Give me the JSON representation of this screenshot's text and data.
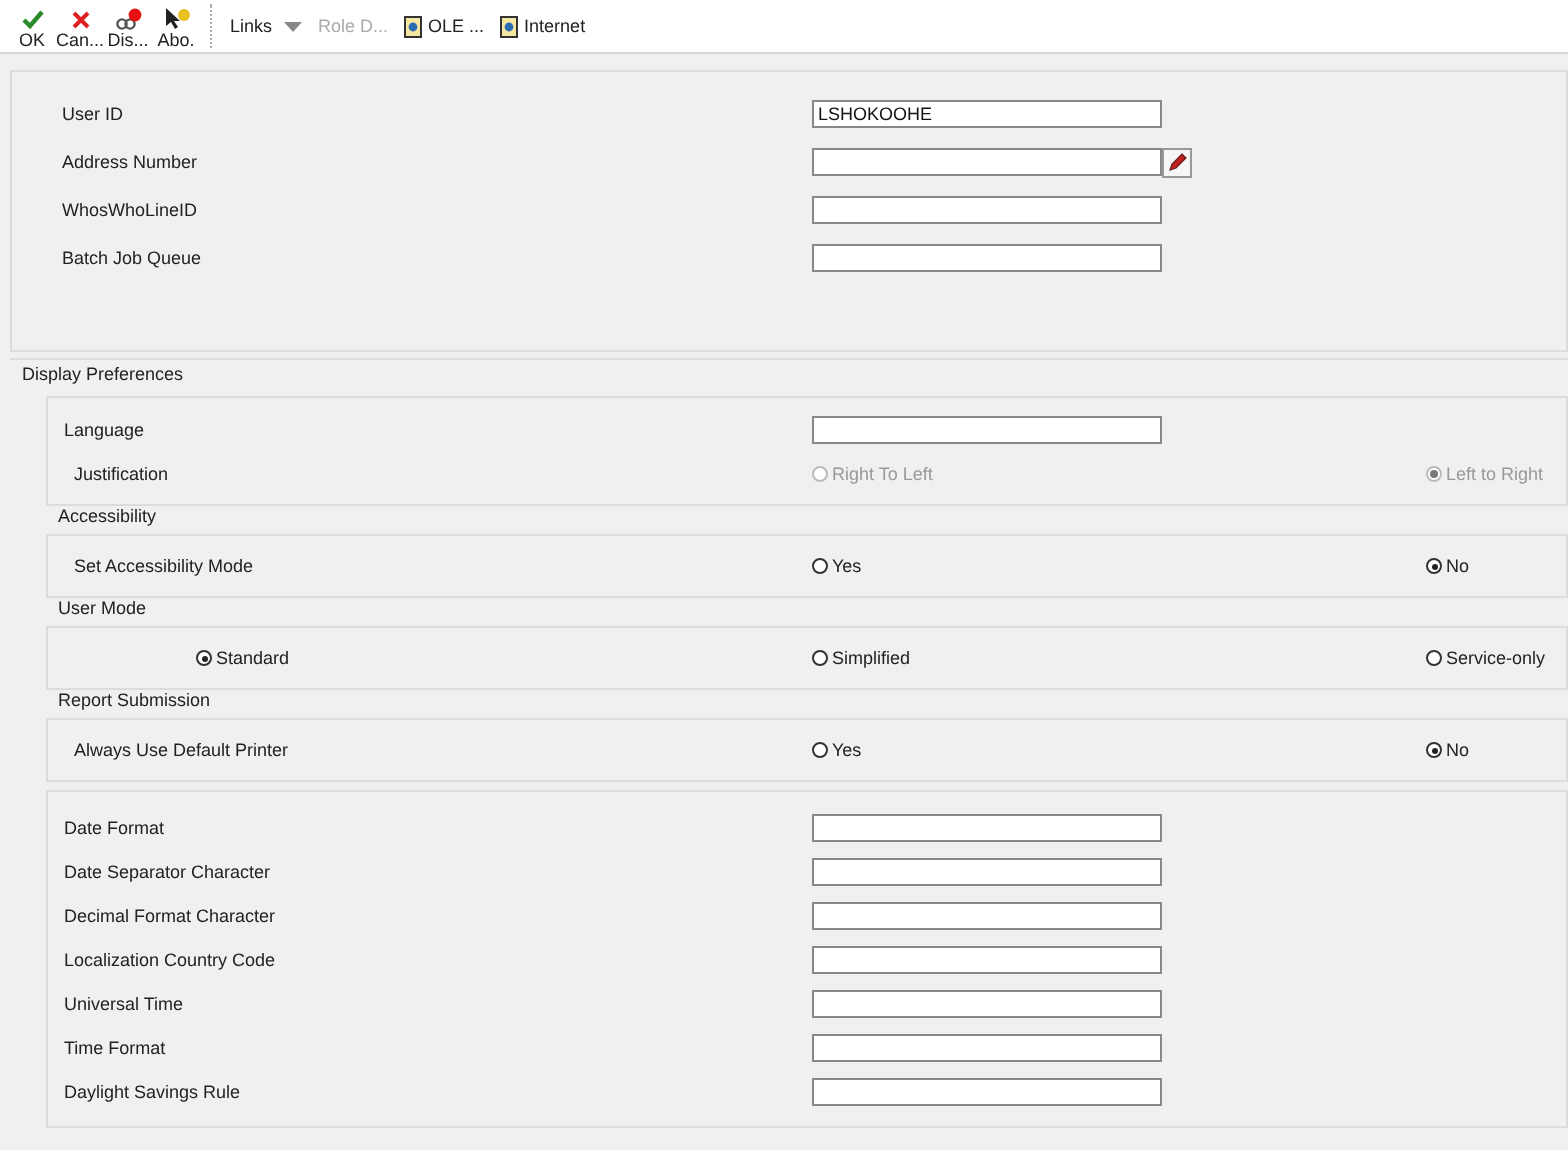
{
  "toolbar": {
    "actions": [
      {
        "label": "OK",
        "kind": "ok"
      },
      {
        "label": "Can...",
        "kind": "cancel"
      },
      {
        "label": "Dis...",
        "kind": "display"
      },
      {
        "label": "Abo.",
        "kind": "about"
      }
    ],
    "menu": {
      "label": "Links"
    },
    "items": [
      {
        "label": "Role D...",
        "kind": "text",
        "disabled": true
      },
      {
        "label": "OLE ...",
        "kind": "doc",
        "disabled": false
      },
      {
        "label": "Internet",
        "kind": "doc",
        "disabled": false
      }
    ]
  },
  "user_fields": [
    {
      "label": "User ID",
      "value": "LSHOKOOHE",
      "lookup": false
    },
    {
      "label": "Address Number",
      "lookup": true
    },
    {
      "label": "WhosWhoLineID",
      "lookup": false
    },
    {
      "label": "Batch Job Queue",
      "lookup": false
    }
  ],
  "display_preferences": {
    "title": "Display Preferences",
    "groups": [
      {
        "rows": [
          {
            "kind": "field",
            "label": "Language"
          },
          {
            "kind": "radio",
            "label": "Justification",
            "disabled": true,
            "options": [
              {
                "label": "Right To Left",
                "selected": false
              },
              {
                "label": "Left to Right",
                "selected": true
              }
            ]
          }
        ]
      },
      {
        "title": "Accessibility",
        "rows": [
          {
            "kind": "radio",
            "label": "Set Accessibility Mode",
            "disabled": false,
            "options": [
              {
                "label": "Yes",
                "selected": false
              },
              {
                "label": "No",
                "selected": true
              }
            ]
          }
        ]
      },
      {
        "title": "User Mode",
        "rows": [
          {
            "kind": "radio",
            "disabled": false,
            "options": [
              {
                "label": "Standard",
                "selected": true
              },
              {
                "label": "Simplified",
                "selected": false
              },
              {
                "label": "Service-only",
                "selected": false
              }
            ]
          }
        ]
      },
      {
        "title": "Report Submission",
        "rows": [
          {
            "kind": "radio",
            "label": "Always Use Default Printer",
            "disabled": false,
            "options": [
              {
                "label": "Yes",
                "selected": false
              },
              {
                "label": "No",
                "selected": true
              }
            ]
          }
        ]
      },
      {
        "rows": [
          {
            "kind": "field",
            "label": "Date Format"
          },
          {
            "kind": "field",
            "label": "Date Separator Character"
          },
          {
            "kind": "field",
            "label": "Decimal Format Character"
          },
          {
            "kind": "field",
            "label": "Localization Country Code"
          },
          {
            "kind": "field",
            "label": "Universal Time"
          },
          {
            "kind": "field",
            "label": "Time Format"
          },
          {
            "kind": "field",
            "label": "Daylight Savings Rule"
          }
        ]
      }
    ]
  }
}
